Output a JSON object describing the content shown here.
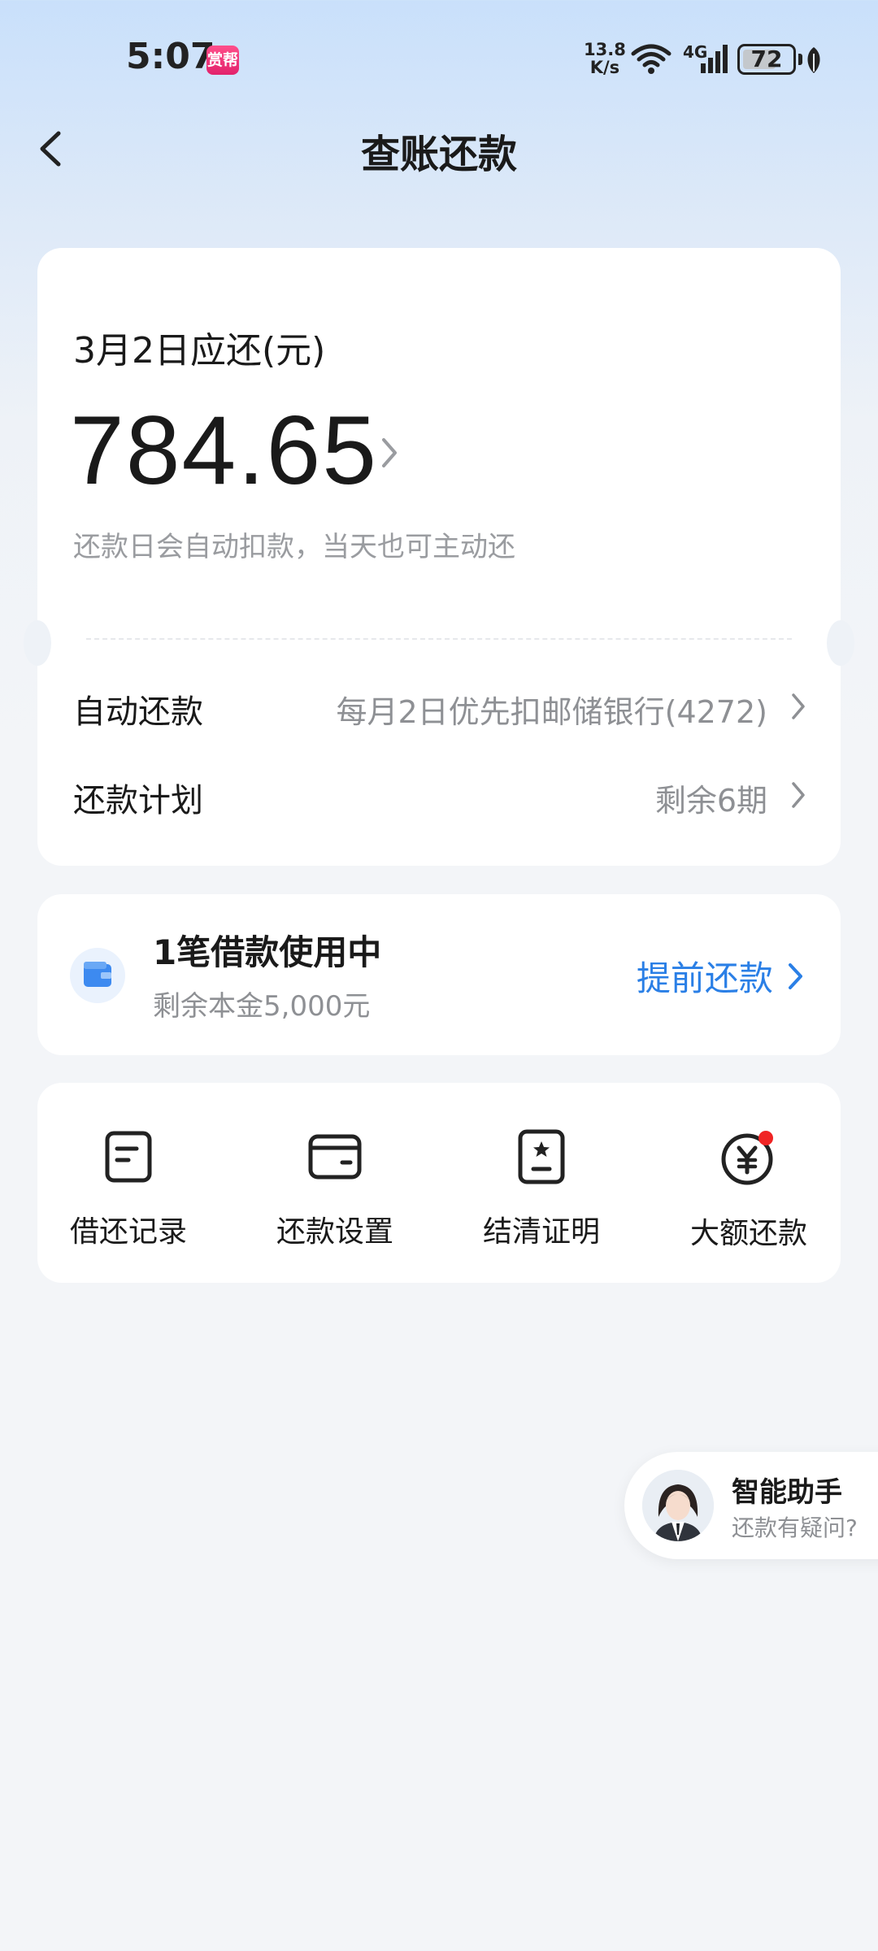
{
  "status_bar": {
    "time": "5:07",
    "app_badge": "赏帮",
    "net_speed_value": "13.8",
    "net_speed_unit": "K/s",
    "network_type": "4G",
    "battery": "72"
  },
  "nav": {
    "title": "查账还款"
  },
  "due_card": {
    "label": "3月2日应还(元)",
    "amount": "784.65",
    "note": "还款日会自动扣款，当天也可主动还",
    "auto_repay": {
      "label": "自动还款",
      "value": "每月2日优先扣邮储银行(4272)"
    },
    "plan": {
      "label": "还款计划",
      "value": "剩余6期"
    }
  },
  "loan_card": {
    "title": "1笔借款使用中",
    "subtitle": "剩余本金5,000元",
    "action": "提前还款"
  },
  "actions": [
    {
      "label": "借还记录",
      "icon": "document-icon"
    },
    {
      "label": "还款设置",
      "icon": "card-icon"
    },
    {
      "label": "结清证明",
      "icon": "certificate-icon"
    },
    {
      "label": "大额还款",
      "icon": "yuan-icon"
    }
  ],
  "assistant": {
    "title": "智能助手",
    "subtitle": "还款有疑问?"
  },
  "colors": {
    "accent": "#2a7fe6",
    "muted_text": "#8e9094",
    "notification_dot": "#f02424"
  }
}
